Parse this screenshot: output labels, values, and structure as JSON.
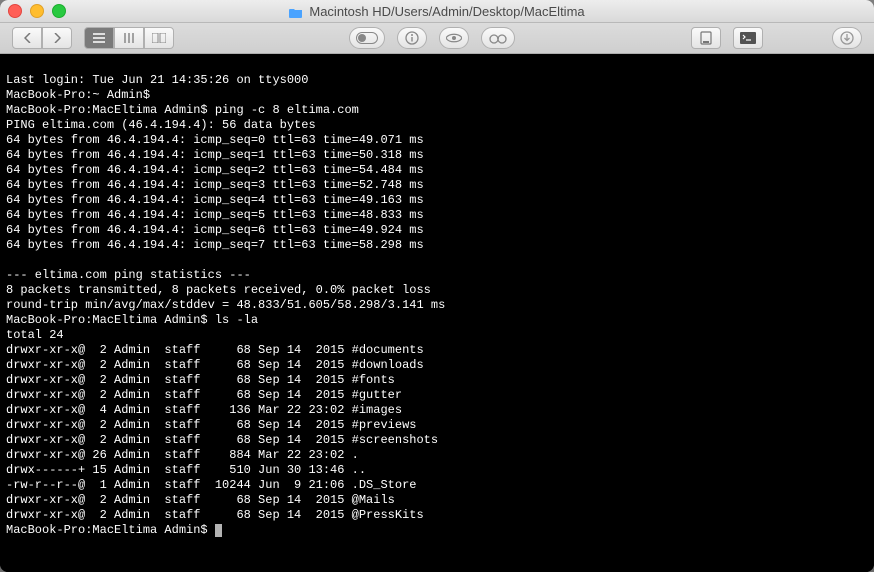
{
  "window": {
    "title": "Macintosh HD/Users/Admin/Desktop/MacEltima"
  },
  "terminal": {
    "last_login": "Last login: Tue Jun 21 14:35:26 on ttys000",
    "prompt_home": "MacBook-Pro:~ Admin$",
    "prompt_dir": "MacBook-Pro:MacEltima Admin$",
    "cmd_ping": "ping -c 8 eltima.com",
    "ping_header": "PING eltima.com (46.4.194.4): 56 data bytes",
    "ping_lines": [
      "64 bytes from 46.4.194.4: icmp_seq=0 ttl=63 time=49.071 ms",
      "64 bytes from 46.4.194.4: icmp_seq=1 ttl=63 time=50.318 ms",
      "64 bytes from 46.4.194.4: icmp_seq=2 ttl=63 time=54.484 ms",
      "64 bytes from 46.4.194.4: icmp_seq=3 ttl=63 time=52.748 ms",
      "64 bytes from 46.4.194.4: icmp_seq=4 ttl=63 time=49.163 ms",
      "64 bytes from 46.4.194.4: icmp_seq=5 ttl=63 time=48.833 ms",
      "64 bytes from 46.4.194.4: icmp_seq=6 ttl=63 time=49.924 ms",
      "64 bytes from 46.4.194.4: icmp_seq=7 ttl=63 time=58.298 ms"
    ],
    "stats_header": "--- eltima.com ping statistics ---",
    "stats_line1": "8 packets transmitted, 8 packets received, 0.0% packet loss",
    "stats_line2": "round-trip min/avg/max/stddev = 48.833/51.605/58.298/3.141 ms",
    "cmd_ls": "ls -la",
    "ls_total": "total 24",
    "ls_rows": [
      "drwxr-xr-x@  2 Admin  staff     68 Sep 14  2015 #documents",
      "drwxr-xr-x@  2 Admin  staff     68 Sep 14  2015 #downloads",
      "drwxr-xr-x@  2 Admin  staff     68 Sep 14  2015 #fonts",
      "drwxr-xr-x@  2 Admin  staff     68 Sep 14  2015 #gutter",
      "drwxr-xr-x@  4 Admin  staff    136 Mar 22 23:02 #images",
      "drwxr-xr-x@  2 Admin  staff     68 Sep 14  2015 #previews",
      "drwxr-xr-x@  2 Admin  staff     68 Sep 14  2015 #screenshots",
      "drwxr-xr-x@ 26 Admin  staff    884 Mar 22 23:02 .",
      "drwx------+ 15 Admin  staff    510 Jun 30 13:46 ..",
      "-rw-r--r--@  1 Admin  staff  10244 Jun  9 21:06 .DS_Store",
      "drwxr-xr-x@  2 Admin  staff     68 Sep 14  2015 @Mails",
      "drwxr-xr-x@  2 Admin  staff     68 Sep 14  2015 @PressKits"
    ]
  }
}
